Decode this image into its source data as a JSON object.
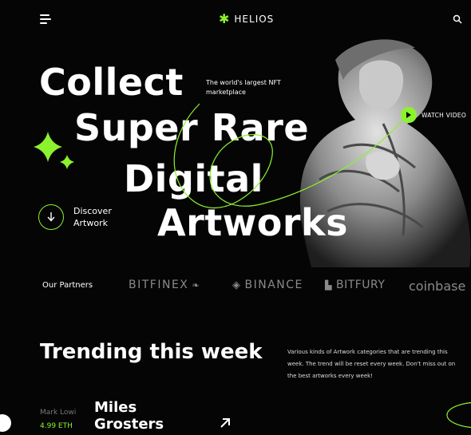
{
  "header": {
    "brand": "HELIOS",
    "brand_icon": "asterisk-icon",
    "menu_icon": "hamburger-icon",
    "search_icon": "search-icon"
  },
  "hero": {
    "line1": "Collect",
    "line2": "Super Rare",
    "line3": "Digital",
    "line4": "Artworks",
    "tagline": "The world's  largest NFT marketplace",
    "watch_label": "WATCH VIDEO",
    "discover_label": "Discover Artwork"
  },
  "partners": {
    "label": "Our Partners",
    "items": [
      "BITFINEX",
      "BINANCE",
      "BITFURY",
      "coinbase"
    ]
  },
  "trending": {
    "title": "Trending this week",
    "description": "Various kinds of Artwork categories that are trending this week. The trend will be reset every week. Don't miss out on the best artworks every week!"
  },
  "card": {
    "owner": "Mark Lowi",
    "price": "4.99 ETH",
    "title": "Miles Grosters"
  },
  "colors": {
    "accent": "#8cf22e",
    "background": "#050505",
    "text": "#ffffff",
    "muted": "#8a8a8a"
  }
}
